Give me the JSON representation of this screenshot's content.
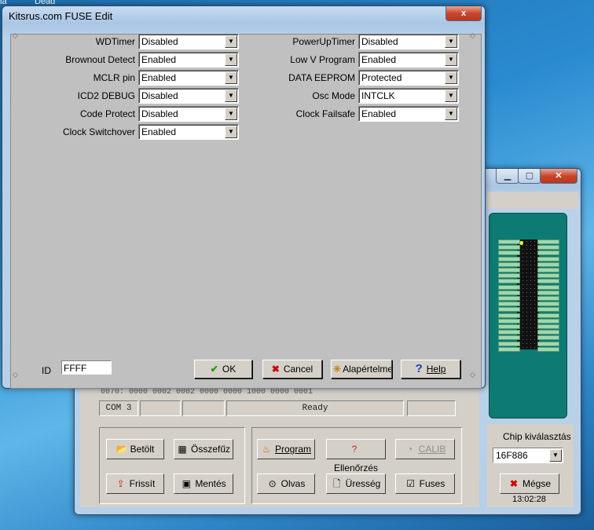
{
  "desktop": {
    "label_left": "ia",
    "label_right": "Dead"
  },
  "fuse_dialog": {
    "title": "Kitsrus.com FUSE Edit",
    "left_fields": [
      {
        "label": "WDTimer",
        "value": "Disabled"
      },
      {
        "label": "Brownout Detect",
        "value": "Enabled"
      },
      {
        "label": "MCLR pin",
        "value": "Enabled"
      },
      {
        "label": "ICD2 DEBUG",
        "value": "Disabled"
      },
      {
        "label": "Code Protect",
        "value": "Disabled"
      },
      {
        "label": "Clock Switchover",
        "value": "Enabled"
      }
    ],
    "right_fields": [
      {
        "label": "PowerUpTimer",
        "value": "Disabled"
      },
      {
        "label": "Low V Program",
        "value": "Enabled"
      },
      {
        "label": "DATA EEPROM",
        "value": "Protected"
      },
      {
        "label": "Osc Mode",
        "value": "INTCLK"
      },
      {
        "label": "Clock Failsafe",
        "value": "Enabled"
      }
    ],
    "id_label": "ID",
    "id_value": "FFFF",
    "buttons": {
      "ok": "OK",
      "cancel": "Cancel",
      "default": "Alapértelmez",
      "help": "Help"
    },
    "close_glyph": "x"
  },
  "programmer_window": {
    "status": {
      "port": "COM 3",
      "state": "Ready",
      "hex_line": "0070: 0000 0002 0002 0000 0000 1000 0000 0001"
    },
    "buttons": {
      "load": "Betölt",
      "merge": "Összefűz",
      "refresh": "Frissít",
      "save": "Mentés",
      "program": "Program",
      "verify": "Ellenőrzés",
      "calib": "CALIB",
      "read": "Olvas",
      "blank": "Üresség",
      "fuses": "Fuses"
    },
    "chip_select_label": "Chip kiválasztás",
    "chip_value": "16F886",
    "cancel_button": "Mégse",
    "clock": "13:02:28"
  },
  "colors": {
    "dialog_bg": "#c0c0c0",
    "chip_board": "#0d7a73",
    "close_red": "#c8462d"
  }
}
